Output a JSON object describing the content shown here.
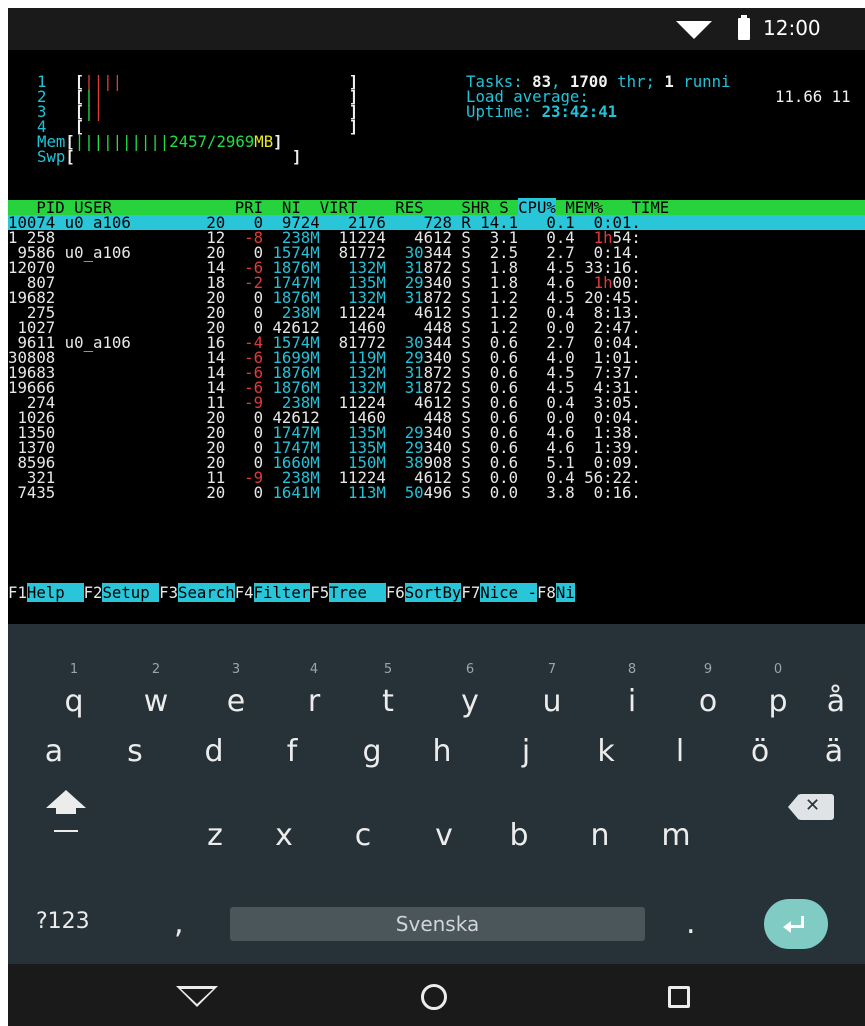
{
  "status_bar": {
    "time": "12:00",
    "icons": [
      "wifi-icon",
      "battery-icon"
    ]
  },
  "meters": {
    "cpu": [
      {
        "num": "1",
        "open": "[",
        "bars": [
          {
            "c": "red",
            "t": "|"
          },
          {
            "c": "red",
            "t": "|"
          },
          {
            "c": "red",
            "t": "|"
          },
          {
            "c": "red",
            "t": "|"
          }
        ],
        "close": "]"
      },
      {
        "num": "2",
        "open": "[",
        "bars": [
          {
            "c": "green",
            "t": "|"
          },
          {
            "c": "red",
            "t": "|"
          }
        ],
        "close": "]"
      },
      {
        "num": "3",
        "open": "[",
        "bars": [
          {
            "c": "green",
            "t": "|"
          },
          {
            "c": "red",
            "t": "|"
          }
        ],
        "close": "]"
      },
      {
        "num": "4",
        "open": "[",
        "bars": [],
        "close": "]"
      }
    ],
    "mem": {
      "label": "Mem",
      "bars": "||||||||||",
      "used": "2457/2969",
      "unit": "MB"
    },
    "swp": {
      "label": "Swp"
    }
  },
  "summary": {
    "tasks_label": "Tasks: ",
    "tasks": "83",
    "sep1": ", ",
    "threads": "1700",
    "thr_label": " thr; ",
    "running": "1",
    "running_label": " runni",
    "load_label": "Load average:",
    "load_values": "11.66 11",
    "uptime_label": "Uptime: ",
    "uptime": "23:42:41"
  },
  "columns": [
    "PID",
    "USER",
    "PRI",
    "NI",
    "VIRT",
    "RES",
    "SHR",
    "S",
    "CPU%",
    "MEM%",
    "TIME"
  ],
  "processes": [
    {
      "pid": "10074",
      "user": "u0_a106",
      "pri": "20",
      "ni": "0",
      "virt": "9724",
      "res": "2176",
      "shr": "728",
      "s": "R",
      "cpu": "14.1",
      "mem": "0.1",
      "time": "0:01."
    },
    {
      "pid": "1 258",
      "user": "",
      "pri": "12",
      "ni": "-8",
      "virt": "238M",
      "res": "11224",
      "shr": "4612",
      "s": "S",
      "cpu": "3.1",
      "mem": "0.4",
      "time": "1h54:"
    },
    {
      "pid": "9586",
      "user": "u0_a106",
      "pri": "20",
      "ni": "0",
      "virt": "1574M",
      "res": "81772",
      "shr": "30344",
      "s": "S",
      "cpu": "2.5",
      "mem": "2.7",
      "time": "0:14."
    },
    {
      "pid": "12070",
      "user": "",
      "pri": "14",
      "ni": "-6",
      "virt": "1876M",
      "res": "132M",
      "shr": "31872",
      "s": "S",
      "cpu": "1.8",
      "mem": "4.5",
      "time": "33:16."
    },
    {
      "pid": "807",
      "user": "",
      "pri": "18",
      "ni": "-2",
      "virt": "1747M",
      "res": "135M",
      "shr": "29340",
      "s": "S",
      "cpu": "1.8",
      "mem": "4.6",
      "time": "1h00:"
    },
    {
      "pid": "19682",
      "user": "",
      "pri": "20",
      "ni": "0",
      "virt": "1876M",
      "res": "132M",
      "shr": "31872",
      "s": "S",
      "cpu": "1.2",
      "mem": "4.5",
      "time": "20:45."
    },
    {
      "pid": "275",
      "user": "",
      "pri": "20",
      "ni": "0",
      "virt": "238M",
      "res": "11224",
      "shr": "4612",
      "s": "S",
      "cpu": "1.2",
      "mem": "0.4",
      "time": "8:13."
    },
    {
      "pid": "1027",
      "user": "",
      "pri": "20",
      "ni": "0",
      "virt": "42612",
      "res": "1460",
      "shr": "448",
      "s": "S",
      "cpu": "1.2",
      "mem": "0.0",
      "time": "2:47."
    },
    {
      "pid": "9611",
      "user": "u0_a106",
      "pri": "16",
      "ni": "-4",
      "virt": "1574M",
      "res": "81772",
      "shr": "30344",
      "s": "S",
      "cpu": "0.6",
      "mem": "2.7",
      "time": "0:04."
    },
    {
      "pid": "30808",
      "user": "",
      "pri": "14",
      "ni": "-6",
      "virt": "1699M",
      "res": "119M",
      "shr": "29340",
      "s": "S",
      "cpu": "0.6",
      "mem": "4.0",
      "time": "1:01."
    },
    {
      "pid": "19683",
      "user": "",
      "pri": "14",
      "ni": "-6",
      "virt": "1876M",
      "res": "132M",
      "shr": "31872",
      "s": "S",
      "cpu": "0.6",
      "mem": "4.5",
      "time": "7:37."
    },
    {
      "pid": "19666",
      "user": "",
      "pri": "14",
      "ni": "-6",
      "virt": "1876M",
      "res": "132M",
      "shr": "31872",
      "s": "S",
      "cpu": "0.6",
      "mem": "4.5",
      "time": "4:31."
    },
    {
      "pid": "274",
      "user": "",
      "pri": "11",
      "ni": "-9",
      "virt": "238M",
      "res": "11224",
      "shr": "4612",
      "s": "S",
      "cpu": "0.6",
      "mem": "0.4",
      "time": "3:05."
    },
    {
      "pid": "1026",
      "user": "",
      "pri": "20",
      "ni": "0",
      "virt": "42612",
      "res": "1460",
      "shr": "448",
      "s": "S",
      "cpu": "0.6",
      "mem": "0.0",
      "time": "0:04."
    },
    {
      "pid": "1350",
      "user": "",
      "pri": "20",
      "ni": "0",
      "virt": "1747M",
      "res": "135M",
      "shr": "29340",
      "s": "S",
      "cpu": "0.6",
      "mem": "4.6",
      "time": "1:38."
    },
    {
      "pid": "1370",
      "user": "",
      "pri": "20",
      "ni": "0",
      "virt": "1747M",
      "res": "135M",
      "shr": "29340",
      "s": "S",
      "cpu": "0.6",
      "mem": "4.6",
      "time": "1:39."
    },
    {
      "pid": "8596",
      "user": "",
      "pri": "20",
      "ni": "0",
      "virt": "1660M",
      "res": "150M",
      "shr": "38908",
      "s": "S",
      "cpu": "0.6",
      "mem": "5.1",
      "time": "0:09."
    },
    {
      "pid": "321",
      "user": "",
      "pri": "11",
      "ni": "-9",
      "virt": "238M",
      "res": "11224",
      "shr": "4612",
      "s": "S",
      "cpu": "0.0",
      "mem": "0.4",
      "time": "56:22."
    },
    {
      "pid": "7435",
      "user": "",
      "pri": "20",
      "ni": "0",
      "virt": "1641M",
      "res": "113M",
      "shr": "50496",
      "s": "S",
      "cpu": "0.0",
      "mem": "3.8",
      "time": "0:16."
    }
  ],
  "function_keys": [
    {
      "key": "F1",
      "label": "Help  "
    },
    {
      "key": "F2",
      "label": "Setup "
    },
    {
      "key": "F3",
      "label": "Search"
    },
    {
      "key": "F4",
      "label": "Filter"
    },
    {
      "key": "F5",
      "label": "Tree  "
    },
    {
      "key": "F6",
      "label": "SortBy"
    },
    {
      "key": "F7",
      "label": "Nice -"
    },
    {
      "key": "F8",
      "label": "Ni"
    }
  ],
  "keyboard": {
    "row1": [
      {
        "k": "q",
        "h": "1"
      },
      {
        "k": "w",
        "h": "2"
      },
      {
        "k": "e",
        "h": "3"
      },
      {
        "k": "r",
        "h": "4"
      },
      {
        "k": "t",
        "h": "5"
      },
      {
        "k": "y",
        "h": "6"
      },
      {
        "k": "u",
        "h": "7"
      },
      {
        "k": "i",
        "h": "8"
      },
      {
        "k": "o",
        "h": "9"
      },
      {
        "k": "p",
        "h": "0"
      },
      {
        "k": "å",
        "h": ""
      }
    ],
    "row2": [
      "a",
      "s",
      "d",
      "f",
      "g",
      "h",
      "j",
      "k",
      "l",
      "ö",
      "ä"
    ],
    "row3": [
      "z",
      "x",
      "c",
      "v",
      "b",
      "n",
      "m"
    ],
    "symbols_label": "?123",
    "comma": ",",
    "space_label": "Svenska",
    "period": ".",
    "enter_color": "#80cbc4"
  },
  "colors": {
    "cyan": "#22c3d8",
    "green": "#22dd44",
    "red": "#e03a3a",
    "yellow": "#e8e828",
    "header_bg": "#27d33c",
    "selected_bg": "#28c6d8",
    "keyboard_bg": "#263238"
  }
}
